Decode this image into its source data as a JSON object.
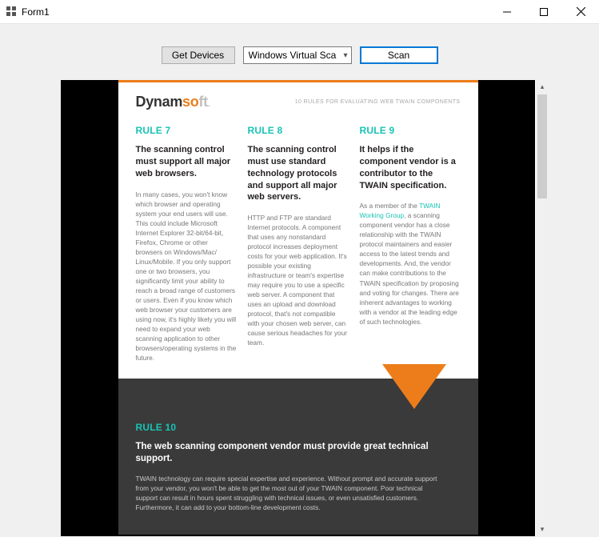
{
  "window": {
    "title": "Form1"
  },
  "toolbar": {
    "get_devices_label": "Get Devices",
    "device_select_value": "Windows Virtual Sca",
    "scan_label": "Scan"
  },
  "document": {
    "brand_main": "Dynam",
    "brand_accent": "s",
    "brand_o": "o",
    "brand_tail": "ft",
    "brand_dot": ".",
    "subtitle": "10 RULES FOR EVALUATING WEB TWAIN COMPONENTS",
    "rules": [
      {
        "label": "RULE 7",
        "heading": "The scanning control must support all major web browsers.",
        "body": "In many cases, you won't know which browser and operating system your end users will use. This could include Microsoft Internet Explorer 32-bit/64-bit, Firefox, Chrome or other browsers on Windows/Mac/ Linux/Mobile. If you only support one or two browsers, you significantly limit your ability to reach a broad range of customers or users. Even if you know which web browser your customers are using now, it's highly likely you will need to expand your web scanning application to other browsers/operating systems in the future."
      },
      {
        "label": "RULE 8",
        "heading": "The scanning control must use standard technology protocols and support all major web servers.",
        "body": "HTTP and FTP are standard Internet protocols. A component that uses any nonstandard protocol increases deployment costs for your web application. It's possible your existing infrastructure or team's expertise may require you to use a specific web server. A component that uses an upload and download protocol, that's not compatible with your chosen web server, can cause serious headaches for your team."
      },
      {
        "label": "RULE 9",
        "heading": "It helps if the component vendor is a contributor to the TWAIN specification.",
        "body_pre": "As a member of the ",
        "link": "TWAIN Working Group",
        "body_post": ", a scanning component vendor has a close relationship with the TWAIN protocol maintainers and easier access to the latest trends and developments. And, the vendor can make contributions to the TWAIN specification by proposing and voting for changes. There are inherent advantages to working with a vendor at the leading edge of such technologies."
      }
    ],
    "rule10": {
      "label": "RULE 10",
      "heading": "The web scanning component vendor must provide great technical support.",
      "body": "TWAIN technology can require special expertise and experience. Without prompt and accurate support from your vendor, you won't be able to get the most out of your TWAIN component. Poor technical support can result in hours spent struggling with technical issues, or even unsatisfied customers. Furthermore, it can add to your bottom-line development costs."
    }
  }
}
